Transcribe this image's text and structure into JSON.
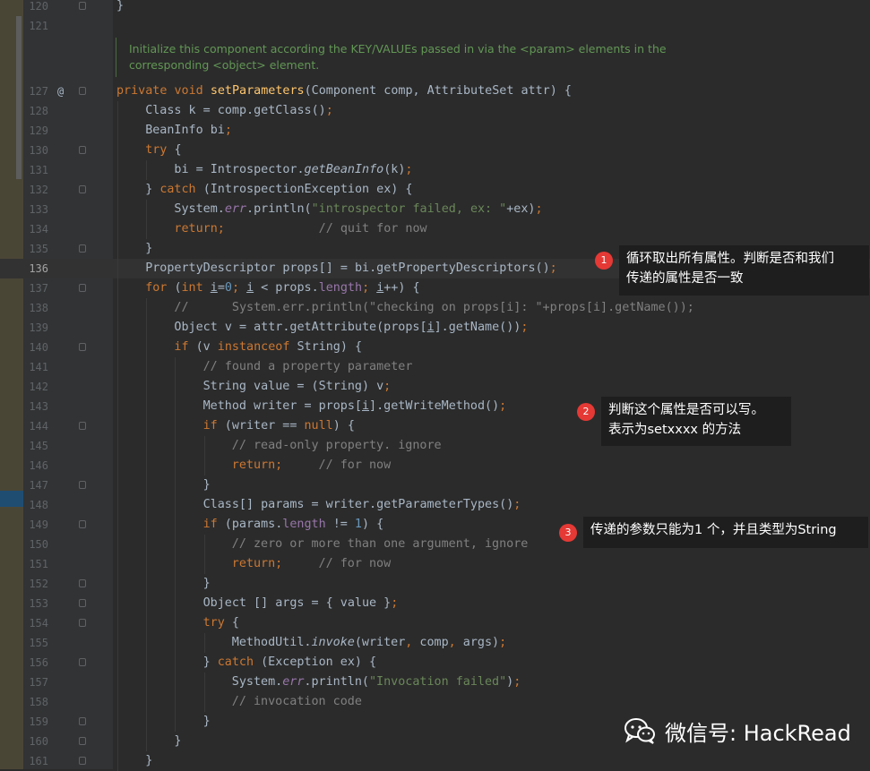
{
  "editor": {
    "lines": [
      {
        "num": "120",
        "indent": 0,
        "tokens": [
          {
            "t": "}"
          }
        ]
      },
      {
        "num": "121",
        "indent": 0,
        "tokens": []
      },
      {
        "num": "127",
        "indent": 0,
        "tokens": [
          {
            "t": "private ",
            "c": "k"
          },
          {
            "t": "void ",
            "c": "k"
          },
          {
            "t": "setParameters",
            "c": "f"
          },
          {
            "t": "(Component comp, AttributeSet attr) {"
          }
        ]
      },
      {
        "num": "128",
        "indent": 1,
        "tokens": [
          {
            "t": "Class k = comp.getClass()"
          },
          {
            "t": ";",
            "c": "k"
          }
        ]
      },
      {
        "num": "129",
        "indent": 1,
        "tokens": [
          {
            "t": "BeanInfo bi"
          },
          {
            "t": ";",
            "c": "k"
          }
        ]
      },
      {
        "num": "130",
        "indent": 1,
        "tokens": [
          {
            "t": "try ",
            "c": "k"
          },
          {
            "t": "{"
          }
        ]
      },
      {
        "num": "131",
        "indent": 2,
        "tokens": [
          {
            "t": "bi = Introspector."
          },
          {
            "t": "getBeanInfo",
            "c": "i"
          },
          {
            "t": "(k)"
          },
          {
            "t": ";",
            "c": "k"
          }
        ]
      },
      {
        "num": "132",
        "indent": 1,
        "tokens": [
          {
            "t": "} "
          },
          {
            "t": "catch ",
            "c": "k"
          },
          {
            "t": "(IntrospectionException ex) {"
          }
        ]
      },
      {
        "num": "133",
        "indent": 2,
        "tokens": [
          {
            "t": "System."
          },
          {
            "t": "err",
            "c": "st"
          },
          {
            "t": ".println("
          },
          {
            "t": "\"introspector failed, ex: \"",
            "c": "s"
          },
          {
            "t": "+ex)"
          },
          {
            "t": ";",
            "c": "k"
          }
        ]
      },
      {
        "num": "134",
        "indent": 2,
        "tokens": [
          {
            "t": "return",
            "c": "k"
          },
          {
            "t": ";",
            "c": "k"
          },
          {
            "t": "             "
          },
          {
            "t": "// quit for now",
            "c": "c"
          }
        ]
      },
      {
        "num": "135",
        "indent": 1,
        "tokens": [
          {
            "t": "}"
          }
        ]
      },
      {
        "num": "136",
        "indent": 1,
        "tokens": [
          {
            "t": "PropertyDescriptor props[] = bi.getPropertyDescriptors()"
          },
          {
            "t": ";",
            "c": "k"
          }
        ]
      },
      {
        "num": "137",
        "indent": 1,
        "tokens": [
          {
            "t": "for ",
            "c": "k"
          },
          {
            "t": "("
          },
          {
            "t": "int ",
            "c": "k"
          },
          {
            "t": "i",
            "c": "u"
          },
          {
            "t": "="
          },
          {
            "t": "0",
            "c": "n"
          },
          {
            "t": "; ",
            "c": "k"
          },
          {
            "t": "i",
            "c": "u"
          },
          {
            "t": " < props."
          },
          {
            "t": "length",
            "c": "pf"
          },
          {
            "t": "; ",
            "c": "k"
          },
          {
            "t": "i",
            "c": "u"
          },
          {
            "t": "++) {"
          }
        ]
      },
      {
        "num": "138",
        "indent": 2,
        "tokens": [
          {
            "t": "//      System.err.println(\"checking on props[i]: \"+props[i].getName());",
            "c": "c"
          }
        ]
      },
      {
        "num": "139",
        "indent": 2,
        "tokens": [
          {
            "t": "Object v = attr.getAttribute(props["
          },
          {
            "t": "i",
            "c": "u"
          },
          {
            "t": "].getName())"
          },
          {
            "t": ";",
            "c": "k"
          }
        ]
      },
      {
        "num": "140",
        "indent": 2,
        "tokens": [
          {
            "t": "if ",
            "c": "k"
          },
          {
            "t": "(v "
          },
          {
            "t": "instanceof ",
            "c": "k"
          },
          {
            "t": "String) {"
          }
        ]
      },
      {
        "num": "141",
        "indent": 3,
        "tokens": [
          {
            "t": "// found a property parameter",
            "c": "c"
          }
        ]
      },
      {
        "num": "142",
        "indent": 3,
        "tokens": [
          {
            "t": "String value = (String) v"
          },
          {
            "t": ";",
            "c": "k"
          }
        ]
      },
      {
        "num": "143",
        "indent": 3,
        "tokens": [
          {
            "t": "Method writer = props["
          },
          {
            "t": "i",
            "c": "u"
          },
          {
            "t": "].getWriteMethod()"
          },
          {
            "t": ";",
            "c": "k"
          }
        ]
      },
      {
        "num": "144",
        "indent": 3,
        "tokens": [
          {
            "t": "if ",
            "c": "k"
          },
          {
            "t": "(writer == "
          },
          {
            "t": "null",
            "c": "k"
          },
          {
            "t": ") {"
          }
        ]
      },
      {
        "num": "145",
        "indent": 4,
        "tokens": [
          {
            "t": "// read-only property. ignore",
            "c": "c"
          }
        ]
      },
      {
        "num": "146",
        "indent": 4,
        "tokens": [
          {
            "t": "return",
            "c": "k"
          },
          {
            "t": ";",
            "c": "k"
          },
          {
            "t": "     "
          },
          {
            "t": "// for now",
            "c": "c"
          }
        ]
      },
      {
        "num": "147",
        "indent": 3,
        "tokens": [
          {
            "t": "}"
          }
        ]
      },
      {
        "num": "148",
        "indent": 3,
        "tokens": [
          {
            "t": "Class[] params = writer.getParameterTypes()"
          },
          {
            "t": ";",
            "c": "k"
          }
        ]
      },
      {
        "num": "149",
        "indent": 3,
        "tokens": [
          {
            "t": "if ",
            "c": "k"
          },
          {
            "t": "(params."
          },
          {
            "t": "length",
            "c": "pf"
          },
          {
            "t": " != "
          },
          {
            "t": "1",
            "c": "n"
          },
          {
            "t": ") {"
          }
        ]
      },
      {
        "num": "150",
        "indent": 4,
        "tokens": [
          {
            "t": "// zero or more than one argument, ignore",
            "c": "c"
          }
        ]
      },
      {
        "num": "151",
        "indent": 4,
        "tokens": [
          {
            "t": "return",
            "c": "k"
          },
          {
            "t": ";",
            "c": "k"
          },
          {
            "t": "     "
          },
          {
            "t": "// for now",
            "c": "c"
          }
        ]
      },
      {
        "num": "152",
        "indent": 3,
        "tokens": [
          {
            "t": "}"
          }
        ]
      },
      {
        "num": "153",
        "indent": 3,
        "tokens": [
          {
            "t": "Object [] args = { value }"
          },
          {
            "t": ";",
            "c": "k"
          }
        ]
      },
      {
        "num": "154",
        "indent": 3,
        "tokens": [
          {
            "t": "try ",
            "c": "k"
          },
          {
            "t": "{"
          }
        ]
      },
      {
        "num": "155",
        "indent": 4,
        "tokens": [
          {
            "t": "MethodUtil."
          },
          {
            "t": "invoke",
            "c": "i"
          },
          {
            "t": "(writer"
          },
          {
            "t": ", ",
            "c": "k"
          },
          {
            "t": "comp"
          },
          {
            "t": ", ",
            "c": "k"
          },
          {
            "t": "args)"
          },
          {
            "t": ";",
            "c": "k"
          }
        ]
      },
      {
        "num": "156",
        "indent": 3,
        "tokens": [
          {
            "t": "} "
          },
          {
            "t": "catch ",
            "c": "k"
          },
          {
            "t": "(Exception ex) {"
          }
        ]
      },
      {
        "num": "157",
        "indent": 4,
        "tokens": [
          {
            "t": "System."
          },
          {
            "t": "err",
            "c": "st"
          },
          {
            "t": ".println("
          },
          {
            "t": "\"Invocation failed\"",
            "c": "s"
          },
          {
            "t": ")"
          },
          {
            "t": ";",
            "c": "k"
          }
        ]
      },
      {
        "num": "158",
        "indent": 4,
        "tokens": [
          {
            "t": "// invocation code",
            "c": "c"
          }
        ]
      },
      {
        "num": "159",
        "indent": 3,
        "tokens": [
          {
            "t": "}"
          }
        ]
      },
      {
        "num": "160",
        "indent": 2,
        "tokens": [
          {
            "t": "}"
          }
        ]
      },
      {
        "num": "161",
        "indent": 1,
        "tokens": [
          {
            "t": "}"
          }
        ]
      }
    ],
    "current_line": "136",
    "override_marker_line": "127",
    "override_marker": "@",
    "doc_comment": {
      "line1": "Initialize this component according the KEY/VALUEs passed in via the <param> elements in the",
      "line2": "corresponding <object> element."
    }
  },
  "annotations": [
    {
      "num": "1",
      "line1": "循环取出所有属性。判断是否和我们",
      "line2": "传递的属性是否一致"
    },
    {
      "num": "2",
      "line1": "判断这个属性是否可以写。",
      "line2": "表示为setxxxx 的方法"
    },
    {
      "num": "3",
      "line1": "传递的参数只能为1 个，并且类型为String",
      "line2": ""
    }
  ],
  "watermark": {
    "text": "微信号: HackRead",
    "icon": "wechat-icon"
  },
  "colors": {
    "background": "#2b2b2b",
    "keyword": "#cc7832",
    "method": "#ffc66d",
    "string": "#6a8759",
    "comment": "#808080",
    "annotation_badge": "#e53935"
  }
}
